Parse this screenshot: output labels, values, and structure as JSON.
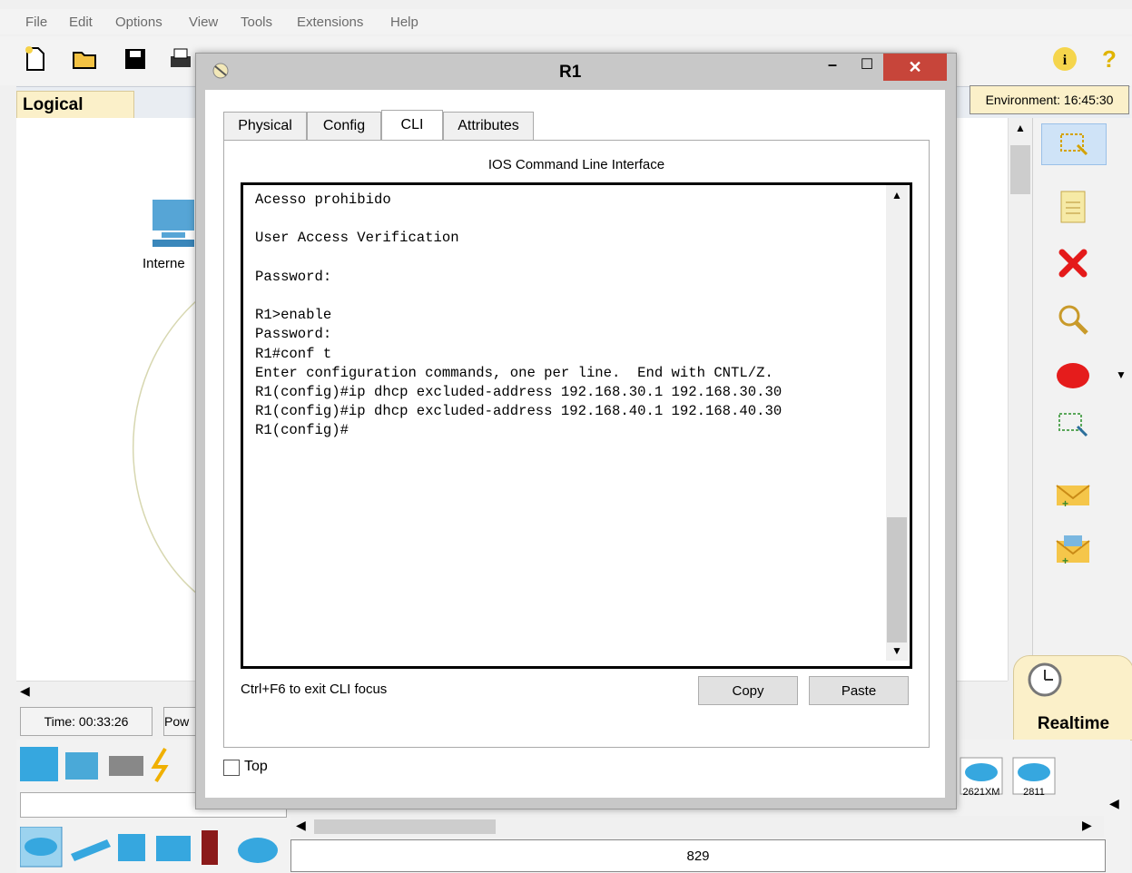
{
  "menu": [
    "File",
    "Edit",
    "Options",
    "View",
    "Tools",
    "Extensions",
    "Help"
  ],
  "workspace": {
    "logical_label": "Logical",
    "environment_label": "Environment: 16:45:30",
    "device_label": "Interne",
    "time_label": "Time: 00:33:26",
    "power_label": "Pow",
    "realtime_label": "Realtime",
    "router_models": [
      "2621XM",
      "2811"
    ],
    "bottom_value": "829"
  },
  "dialog": {
    "title": "R1",
    "tabs": [
      "Physical",
      "Config",
      "CLI",
      "Attributes"
    ],
    "active_tab": "CLI",
    "cli_heading": "IOS Command Line Interface",
    "cli_lines": "Acesso prohibido\n\nUser Access Verification\n\nPassword:\n\nR1>enable\nPassword:\nR1#conf t\nEnter configuration commands, one per line.  End with CNTL/Z.\nR1(config)#ip dhcp excluded-address 192.168.30.1 192.168.30.30\nR1(config)#ip dhcp excluded-address 192.168.40.1 192.168.40.30\nR1(config)#",
    "exit_hint": "Ctrl+F6 to exit CLI focus",
    "copy_label": "Copy",
    "paste_label": "Paste",
    "top_label": "Top",
    "close_glyph": "✕",
    "min_glyph": "–",
    "max_glyph": "☐"
  }
}
